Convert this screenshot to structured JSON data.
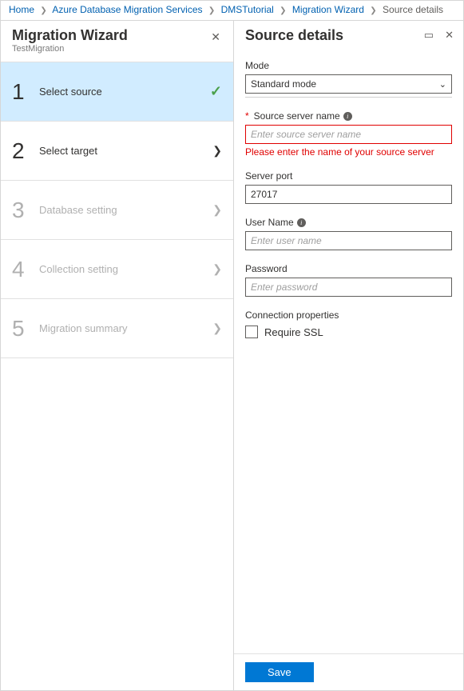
{
  "breadcrumb": {
    "items": [
      "Home",
      "Azure Database Migration Services",
      "DMSTutorial",
      "Migration Wizard"
    ],
    "current": "Source details"
  },
  "left": {
    "title": "Migration Wizard",
    "subtitle": "TestMigration"
  },
  "steps": [
    {
      "num": "1",
      "label": "Select source",
      "active": true,
      "check": true
    },
    {
      "num": "2",
      "label": "Select target",
      "active": false
    },
    {
      "num": "3",
      "label": "Database setting",
      "active": false,
      "disabled": true
    },
    {
      "num": "4",
      "label": "Collection setting",
      "active": false,
      "disabled": true
    },
    {
      "num": "5",
      "label": "Migration summary",
      "active": false,
      "disabled": true
    }
  ],
  "right": {
    "title": "Source details"
  },
  "form": {
    "mode": {
      "label": "Mode",
      "value": "Standard mode"
    },
    "source_server": {
      "label": "Source server name",
      "placeholder": "Enter source server name",
      "value": "",
      "error": "Please enter the name of your source server"
    },
    "port": {
      "label": "Server port",
      "value": "27017"
    },
    "user": {
      "label": "User Name",
      "placeholder": "Enter user name",
      "value": ""
    },
    "password": {
      "label": "Password",
      "placeholder": "Enter password",
      "value": ""
    },
    "conn_props": {
      "label": "Connection properties",
      "ssl_label": "Require SSL",
      "ssl_checked": false
    }
  },
  "footer": {
    "save": "Save"
  }
}
